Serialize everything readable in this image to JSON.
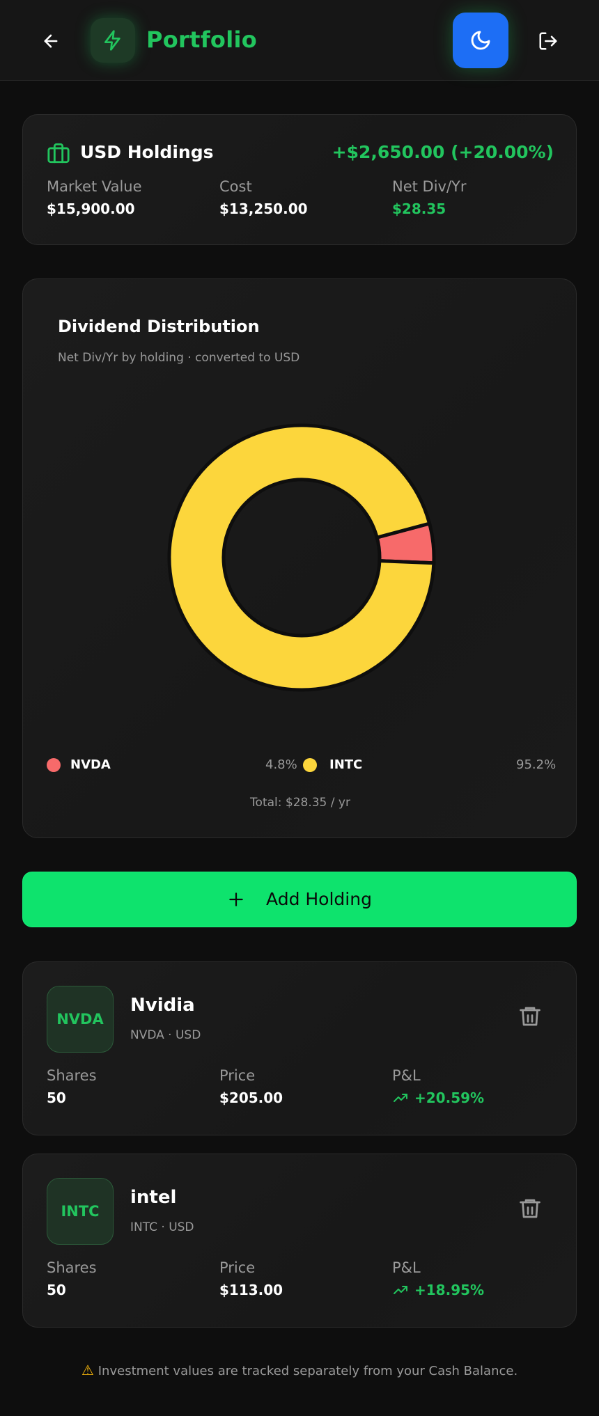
{
  "header": {
    "title": "Portfolio",
    "icons": [
      "arrow-left-icon",
      "lightning-icon",
      "moon-icon",
      "logout-icon"
    ],
    "accent": "#22c55e",
    "theme_button_color": "#1d6ef5"
  },
  "summary": {
    "title": "USD Holdings",
    "gain": "+$2,650.00 (+20.00%)",
    "market_value_label": "Market Value",
    "market_value": "$15,900.00",
    "cost_label": "Cost",
    "cost": "$13,250.00",
    "net_div_label": "Net Div/Yr",
    "net_div": "$28.35"
  },
  "dividend_card": {
    "title": "Dividend Distribution",
    "subtitle": "Net Div/Yr by holding · converted to USD",
    "total": "Total: $28.35 / yr",
    "legend": [
      {
        "name": "NVDA",
        "pct": "4.8%"
      },
      {
        "name": "INTC",
        "pct": "95.2%"
      }
    ]
  },
  "chart_data": {
    "type": "pie",
    "categories": [
      "NVDA",
      "INTC"
    ],
    "values": [
      4.8,
      95.2
    ],
    "colors": [
      "#f76a6a",
      "#fcd63c"
    ],
    "title": "Dividend Distribution",
    "legend_position": "bottom"
  },
  "add_button": {
    "label": "Add Holding"
  },
  "holdings": [
    {
      "ticker": "NVDA",
      "name": "Nvidia",
      "sub": "NVDA · USD",
      "shares_label": "Shares",
      "shares": "50",
      "price_label": "Price",
      "price": "$205.00",
      "pl_label": "P&L",
      "pl": "+20.59%"
    },
    {
      "ticker": "INTC",
      "name": "intel",
      "sub": "INTC · USD",
      "shares_label": "Shares",
      "shares": "50",
      "price_label": "Price",
      "price": "$113.00",
      "pl_label": "P&L",
      "pl": "+18.95%"
    }
  ],
  "footer": {
    "note": "Investment values are tracked separately from your Cash Balance."
  }
}
